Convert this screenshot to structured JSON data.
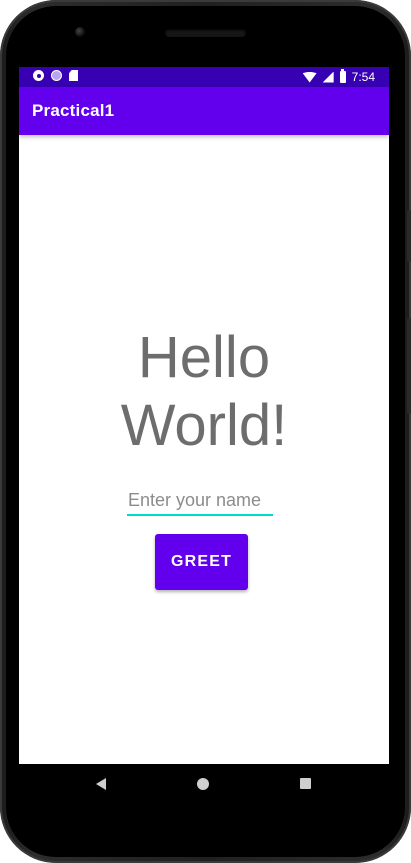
{
  "status_bar": {
    "time": "7:54",
    "icons": [
      "settings-icon",
      "circle-icon",
      "sd-card-icon",
      "wifi-icon",
      "signal-icon",
      "battery-icon"
    ],
    "background": "#3700B3"
  },
  "app_bar": {
    "title": "Practical1",
    "background": "#6200EE"
  },
  "main": {
    "hello_line1": "Hello",
    "hello_line2": "World!",
    "name_input": {
      "placeholder": "Enter your name",
      "value": "",
      "underline_color": "#03DAC5"
    },
    "greet_button": {
      "label": "GREET",
      "color": "#6200EE"
    }
  },
  "nav_bar": {
    "icons": [
      "back-icon",
      "home-icon",
      "recents-icon"
    ]
  }
}
